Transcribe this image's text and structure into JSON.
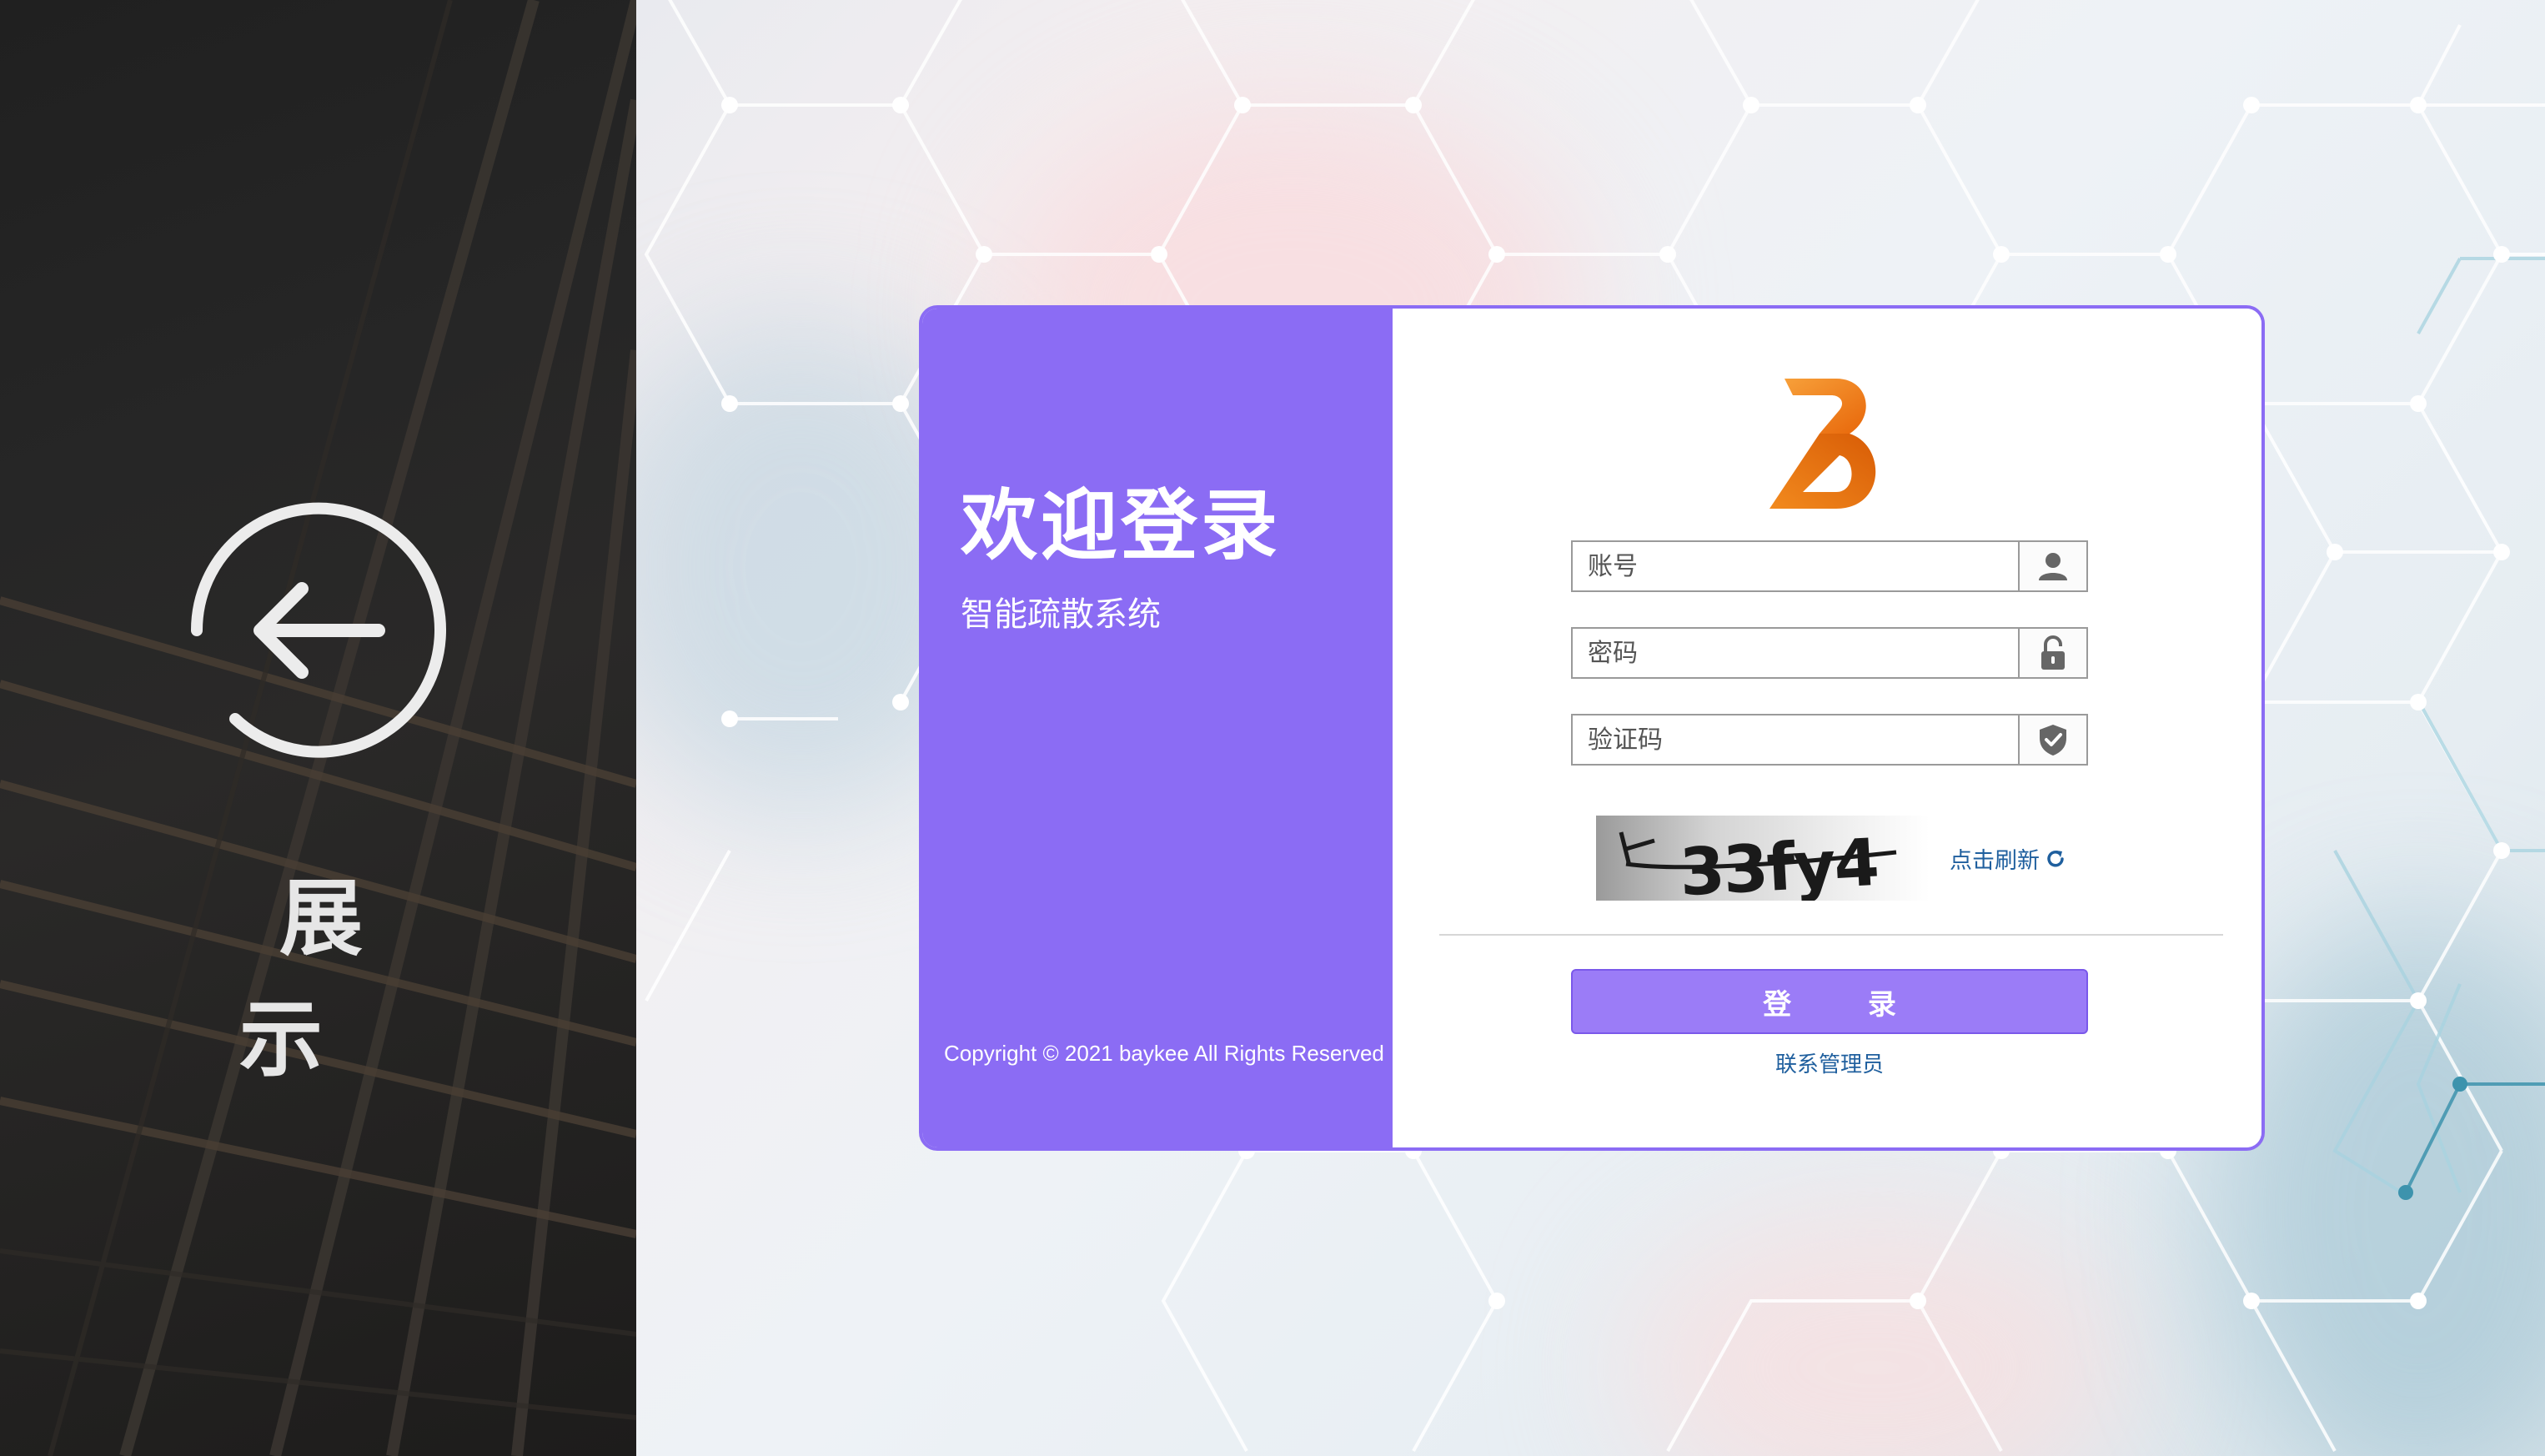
{
  "sidebar": {
    "back_label": "展 示"
  },
  "login_card": {
    "welcome_title": "欢迎登录",
    "system_name": "智能疏散系统",
    "copyright": "Copyright © 2021 baykee All Rights Reserved",
    "brand_logo_letter": "B",
    "account": {
      "placeholder": "账号",
      "value": "",
      "icon": "user-icon"
    },
    "password": {
      "placeholder": "密码",
      "value": "",
      "icon": "lock-icon"
    },
    "captcha": {
      "placeholder": "验证码",
      "value": "",
      "icon": "shield-check-icon"
    },
    "captcha_image_text": "33fy4",
    "refresh_label": "点击刷新",
    "login_button": "登 录",
    "contact_admin": "联系管理员"
  },
  "colors": {
    "accent_purple": "#8b6cf4",
    "button_purple": "#9b7cf7",
    "logo_orange": "#f07d16",
    "link_blue": "#1f5f9e",
    "sidebar_dark": "#222222"
  }
}
